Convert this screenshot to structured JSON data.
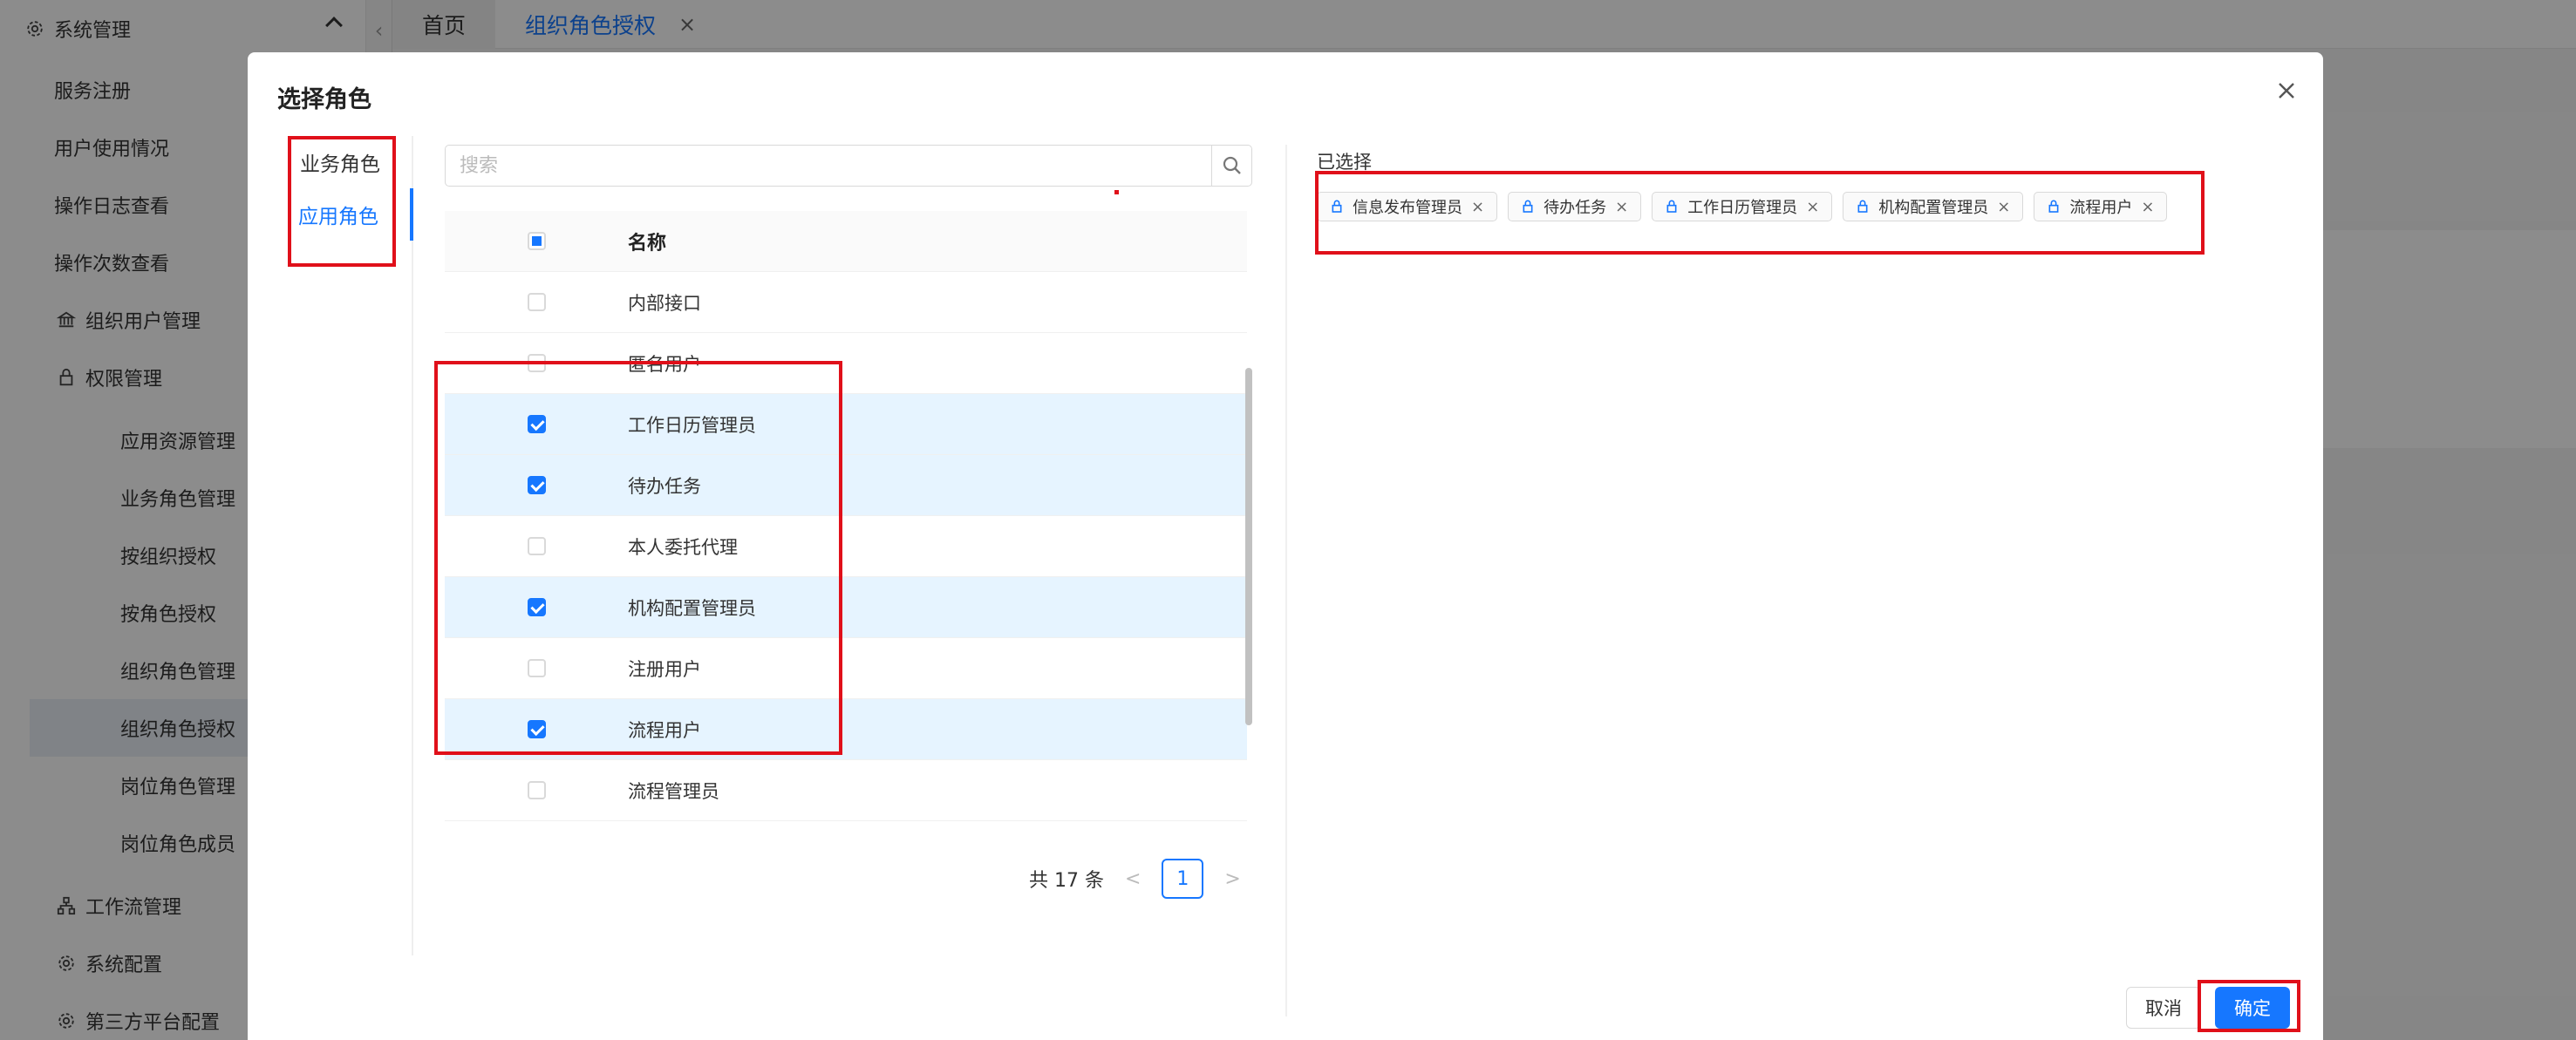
{
  "sidebar": {
    "group_title": "系统管理",
    "items": [
      {
        "label": "服务注册",
        "icon": "none"
      },
      {
        "label": "用户使用情况",
        "icon": "none"
      },
      {
        "label": "操作日志查看",
        "icon": "none"
      },
      {
        "label": "操作次数查看",
        "icon": "none"
      },
      {
        "label": "组织用户管理",
        "icon": "bank-icon"
      },
      {
        "label": "权限管理",
        "icon": "lock-icon"
      },
      {
        "label": "应用资源管理",
        "icon": "none"
      },
      {
        "label": "业务角色管理",
        "icon": "none"
      },
      {
        "label": "按组织授权",
        "icon": "none"
      },
      {
        "label": "按角色授权",
        "icon": "none"
      },
      {
        "label": "组织角色管理",
        "icon": "none"
      },
      {
        "label": "组织角色授权",
        "icon": "none",
        "active": true
      },
      {
        "label": "岗位角色管理",
        "icon": "none"
      },
      {
        "label": "岗位角色成员",
        "icon": "none"
      },
      {
        "label": "工作流管理",
        "icon": "workflow-icon"
      },
      {
        "label": "系统配置",
        "icon": "gear-icon"
      },
      {
        "label": "第三方平台配置",
        "icon": "gear-icon"
      }
    ]
  },
  "tabs": {
    "home": "首页",
    "current": "组织角色授权",
    "close": "×"
  },
  "modal": {
    "title": "选择角色",
    "role_types": [
      "业务角色",
      "应用角色"
    ],
    "active_role_type": "应用角色",
    "search": {
      "placeholder": "搜索",
      "value": ""
    },
    "table": {
      "header_name": "名称",
      "rows": [
        {
          "name": "内部接口",
          "checked": false
        },
        {
          "name": "匿名用户",
          "checked": false
        },
        {
          "name": "工作日历管理员",
          "checked": true
        },
        {
          "name": "待办任务",
          "checked": true
        },
        {
          "name": "本人委托代理",
          "checked": false
        },
        {
          "name": "机构配置管理员",
          "checked": true
        },
        {
          "name": "注册用户",
          "checked": false
        },
        {
          "name": "流程用户",
          "checked": true
        },
        {
          "name": "流程管理员",
          "checked": false
        }
      ]
    },
    "pagination": {
      "total_text": "共 17 条",
      "prev": "<",
      "current_page": "1",
      "next": ">"
    },
    "selected": {
      "label": "已选择",
      "tags": [
        "信息发布管理员",
        "待办任务",
        "工作日历管理员",
        "机构配置管理员",
        "流程用户"
      ],
      "tag_icon": "role-icon",
      "tag_close": "×"
    },
    "cancel_label": "取消",
    "ok_label": "确定"
  },
  "colors": {
    "accent": "#1677ff",
    "highlight_box": "#e0101a",
    "selected_row_bg": "#e6f4ff"
  }
}
